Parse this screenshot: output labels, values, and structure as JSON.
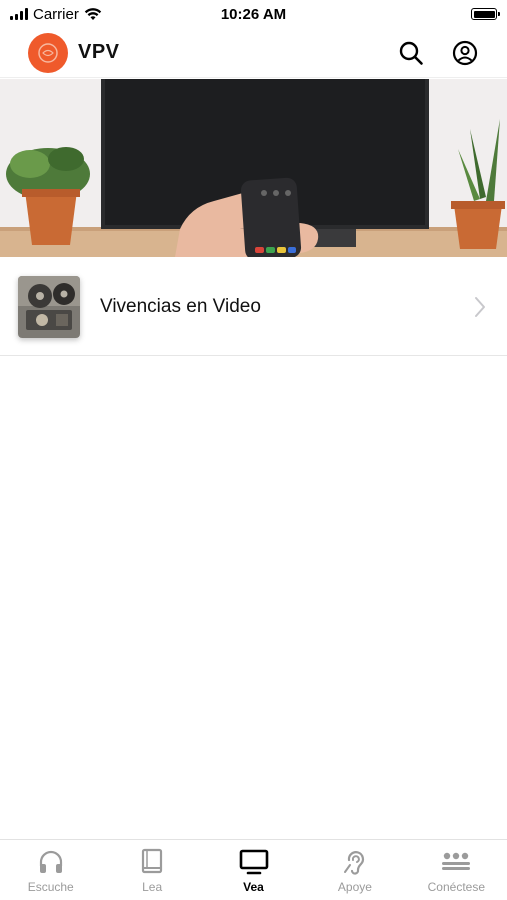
{
  "status_bar": {
    "carrier": "Carrier",
    "time": "10:26 AM",
    "icons": [
      "signal-icon",
      "wifi-icon",
      "battery-icon"
    ]
  },
  "header": {
    "brand": "VPV",
    "logo_color": "#ef5a2b",
    "actions": [
      "search-icon",
      "profile-icon"
    ]
  },
  "hero": {
    "description_icon": "tv-remote-photo"
  },
  "list": {
    "items": [
      {
        "label": "Vivencias en Video",
        "icon": "film-projector-thumbnail",
        "trailing_icon": "chevron-right-icon"
      }
    ]
  },
  "tab_bar": {
    "active_color": "#000000",
    "inactive_color": "#9b9b9b",
    "tabs": [
      {
        "label": "Escuche",
        "icon": "headphones-icon",
        "active": false
      },
      {
        "label": "Lea",
        "icon": "book-icon",
        "active": false
      },
      {
        "label": "Vea",
        "icon": "tv-icon",
        "active": true
      },
      {
        "label": "Apoye",
        "icon": "ear-icon",
        "active": false
      },
      {
        "label": "Conéctese",
        "icon": "group-icon",
        "active": false
      }
    ]
  }
}
